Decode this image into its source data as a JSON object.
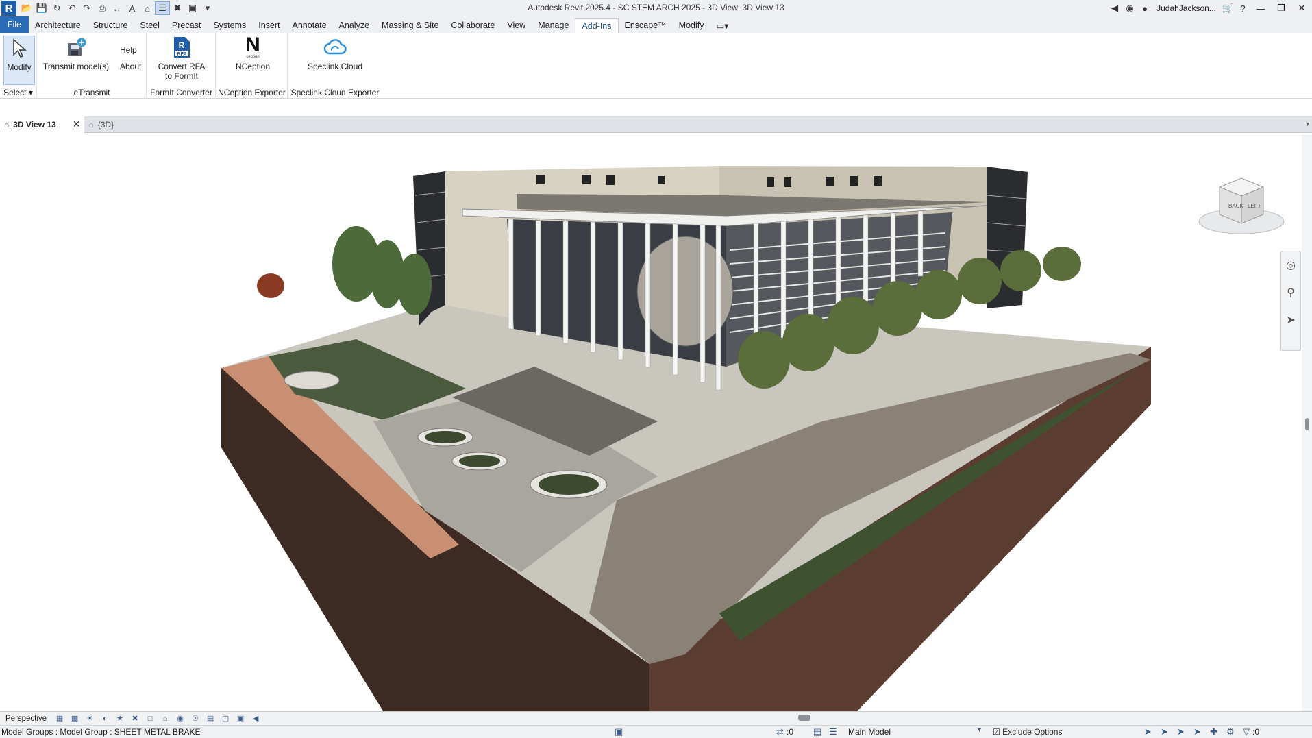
{
  "titlebar": {
    "app_logo": "R",
    "title": "Autodesk Revit 2025.4 - SC STEM ARCH 2025 - 3D View: 3D View 13",
    "user": "JudahJackson...",
    "qat_icons": [
      "open-icon",
      "save-icon",
      "sync-icon",
      "undo-icon",
      "redo-icon",
      "print-icon",
      "measure-icon",
      "text-icon",
      "3d-view-icon",
      "thin-lines-icon",
      "close-hidden-icon",
      "switch-windows-icon"
    ]
  },
  "tabs": {
    "items": [
      "File",
      "Architecture",
      "Structure",
      "Steel",
      "Precast",
      "Systems",
      "Insert",
      "Annotate",
      "Analyze",
      "Massing & Site",
      "Collaborate",
      "View",
      "Manage",
      "Add-Ins",
      "Enscape™",
      "Modify"
    ],
    "active": "Add-Ins"
  },
  "ribbon": {
    "modify_label": "Modify",
    "select_label": "Select",
    "transmit_label": "Transmit model(s)",
    "help_label": "Help",
    "about_label": "About",
    "etransmit_panel": "eTransmit",
    "convert_label_1": "Convert RFA",
    "convert_label_2": "to FormIt",
    "rfa_badge": "RFA",
    "formit_panel": "FormIt Converter",
    "nception_logo": "N",
    "nception_sub": "ception",
    "nception_label": "NCeption",
    "nception_panel": "NCeption Exporter",
    "speclink_label": "Speclink Cloud",
    "speclink_panel": "Speclink Cloud Exporter"
  },
  "viewtabs": {
    "active": "3D View 13",
    "other": "{3D}"
  },
  "viewcube": {
    "back": "BACK",
    "left": "LEFT"
  },
  "viewbar": {
    "mode": "Perspective"
  },
  "statusbar": {
    "selection": "Model Groups : Model Group : SHEET METAL BRAKE",
    "worksets": ":0",
    "model": "Main Model",
    "exclude_options": "Exclude Options",
    "filter_count": ":0"
  },
  "colors": {
    "accent": "#2b6cb7",
    "ground_brown": "#4a3328",
    "grass": "#4a5a3a",
    "paving": "#b9b6ad"
  }
}
